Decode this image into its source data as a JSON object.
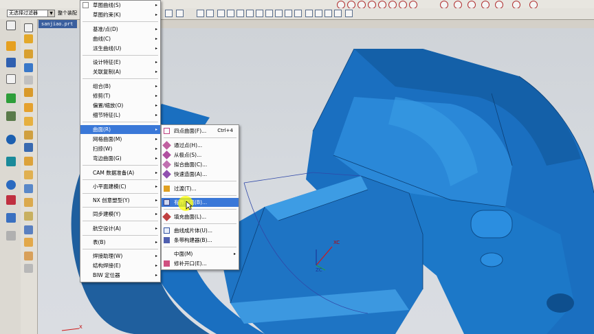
{
  "toolbar": {
    "filter_value": "无选择过滤器",
    "filter_scope": "整个装配"
  },
  "tab": {
    "filename": "sanjiao.prt"
  },
  "triad": {
    "xc": "XC",
    "zc": "ZC",
    "x": "X"
  },
  "main_menu": {
    "items": [
      {
        "label": "草图曲线(S)",
        "sub": "▸"
      },
      {
        "label": "草图约束(K)",
        "sub": "▸"
      },
      {
        "label": "基准/点(D)",
        "sub": "▸"
      },
      {
        "label": "曲线(C)",
        "sub": "▸"
      },
      {
        "label": "派生曲线(U)",
        "sub": "▸"
      },
      {
        "label": "设计特征(E)",
        "sub": "▸"
      },
      {
        "label": "关联复制(A)",
        "sub": "▸"
      },
      {
        "label": "组合(B)",
        "sub": "▸"
      },
      {
        "label": "修剪(T)",
        "sub": "▸"
      },
      {
        "label": "偏置/缩放(O)",
        "sub": "▸"
      },
      {
        "label": "细节特征(L)",
        "sub": "▸"
      },
      {
        "label": "曲面(R)",
        "sub": "▸"
      },
      {
        "label": "网格曲面(M)",
        "sub": "▸"
      },
      {
        "label": "扫掠(W)",
        "sub": "▸"
      },
      {
        "label": "弯边曲面(G)",
        "sub": "▸"
      },
      {
        "label": "CAM 数据准备(A)",
        "sub": "▸"
      },
      {
        "label": "小平面建模(C)",
        "sub": "▸"
      },
      {
        "label": "NX 创意塑型(Y)",
        "sub": "▸"
      },
      {
        "label": "同步建模(Y)",
        "sub": "▸"
      },
      {
        "label": "航空设计(A)",
        "sub": "▸"
      },
      {
        "label": "表(B)",
        "sub": "▸"
      },
      {
        "label": "焊接助理(W)",
        "sub": "▸"
      },
      {
        "label": "结构焊接(E)",
        "sub": "▸"
      },
      {
        "label": "BIW 定位器",
        "sub": "▸"
      }
    ]
  },
  "surface_menu": {
    "items": [
      {
        "label": "四点曲面(F)...",
        "shortcut": "Ctrl+4"
      },
      {
        "label": "通过点(H)..."
      },
      {
        "label": "从极点(S)..."
      },
      {
        "label": "拟合曲面(C)..."
      },
      {
        "label": "快速造面(A)..."
      },
      {
        "label": "过渡(T)..."
      },
      {
        "label": "有界平面(B)..."
      },
      {
        "label": "填充曲面(L)..."
      },
      {
        "label": "曲线成片体(U)..."
      },
      {
        "label": "条带构建器(B)..."
      },
      {
        "label": "中面(M)",
        "sub": "▸"
      },
      {
        "label": "修补开口(E)..."
      }
    ]
  },
  "colors": {
    "model_blue": "#1a6fc0",
    "menu_highlight": "#3a78d8"
  }
}
